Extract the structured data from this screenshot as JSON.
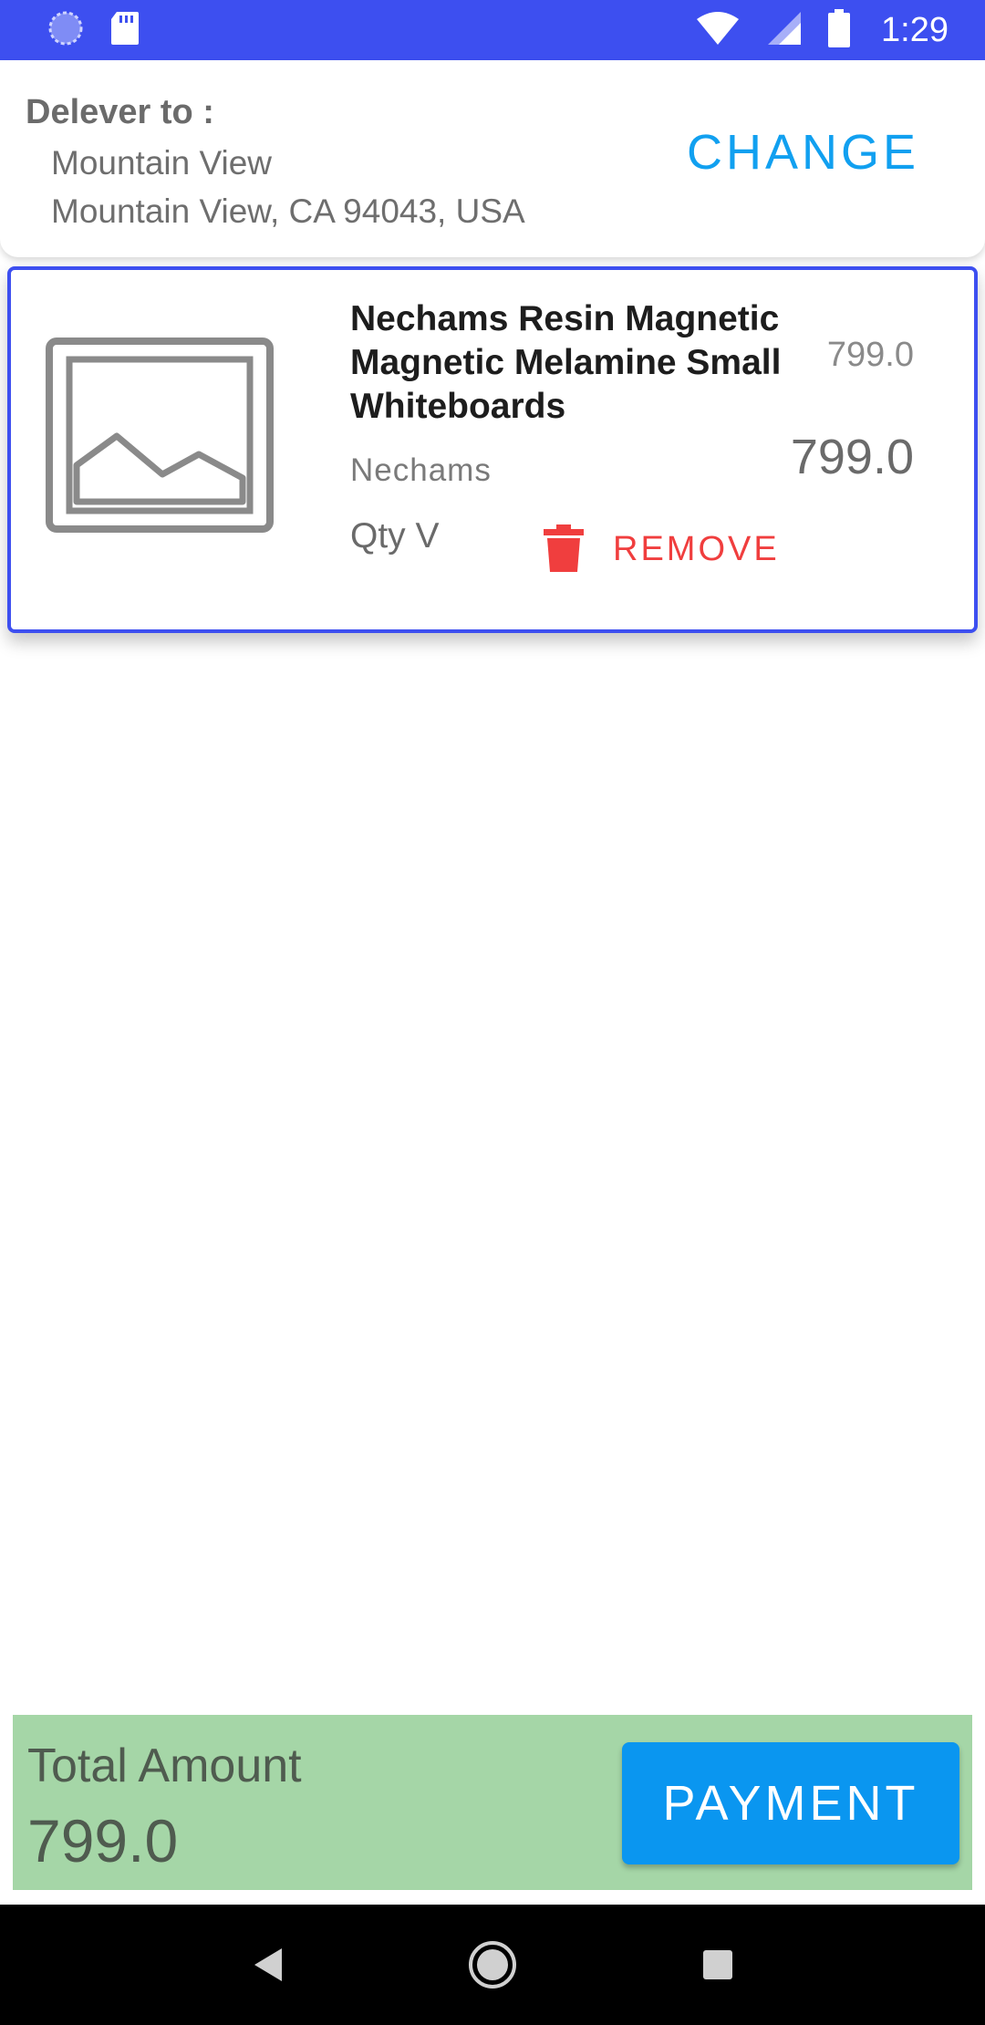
{
  "status_bar": {
    "time": "1:29",
    "icons": [
      "loading-icon",
      "sd-card-icon",
      "wifi-icon",
      "signal-icon",
      "battery-icon"
    ]
  },
  "delivery": {
    "label": "Delever to :",
    "line1": "Mountain View",
    "line2": "Mountain View, CA 94043, USA",
    "change_label": "CHANGE"
  },
  "cart": {
    "items": [
      {
        "title": "Nechams Resin Magnetic Magnetic Melamine Small Whiteboards",
        "original_price": "799.0",
        "price": "799.0",
        "brand": "Nechams",
        "qty_label": "Qty V",
        "remove_label": "REMOVE"
      }
    ]
  },
  "footer": {
    "total_label": "Total Amount",
    "total_value": "799.0",
    "payment_label": "PAYMENT"
  },
  "colors": {
    "status_bar": "#3d4ff0",
    "accent": "#11a0f0",
    "remove": "#f03e3e",
    "total_bar": "#a5d6a7",
    "payment_button": "#0a96f0"
  }
}
